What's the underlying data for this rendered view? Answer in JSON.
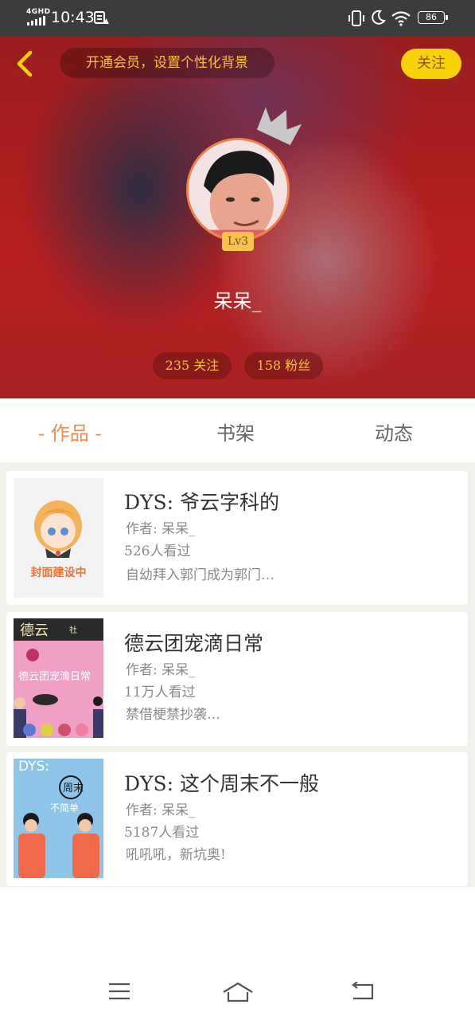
{
  "status_bar": {
    "network": "4GHD",
    "time": "10:43",
    "battery": "86"
  },
  "header": {
    "vip_prompt": "开通会员，设置个性化背景",
    "follow_label": "关注",
    "level": "Lv3",
    "username": "呆呆_",
    "following_count": "235 关注",
    "fans_count": "158 粉丝"
  },
  "tabs": [
    {
      "label": "- 作品 -",
      "active": true
    },
    {
      "label": "书架",
      "active": false
    },
    {
      "label": "动态",
      "active": false
    }
  ],
  "works": [
    {
      "title": "DYS:  爷云字科的",
      "author": "作者: 呆呆_",
      "views": "526人看过",
      "desc": "自幼拜入郭门成为郭门…",
      "cover_text": "封面建设中"
    },
    {
      "title": "德云团宠滴日常",
      "author": "作者: 呆呆_",
      "views": "11万人看过",
      "desc": "禁借梗禁抄袭…",
      "cover_text": "德云团宠滴日常"
    },
    {
      "title": "DYS:  这个周末不一般",
      "author": "作者: 呆呆_",
      "views": "5187人看过",
      "desc": "吼吼吼，新坑奥!",
      "cover_text": "DYS:"
    }
  ],
  "colors": {
    "accent": "#ee8a52",
    "follow_button": "#f7d20a",
    "stat_text": "#f6c23e"
  }
}
